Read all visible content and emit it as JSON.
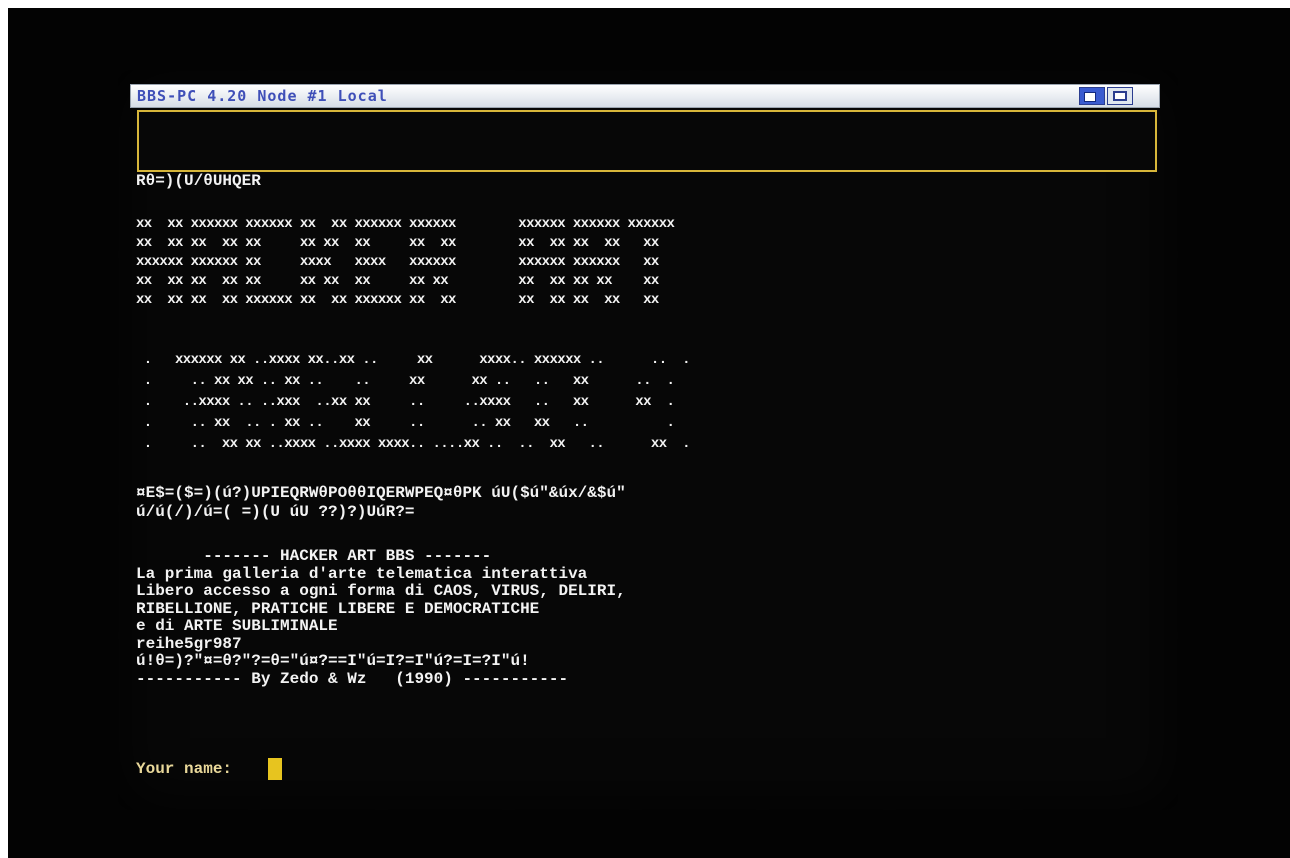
{
  "window": {
    "title": "BBS-PC 4.20 Node #1 Local",
    "gadgets": [
      "depth-icon",
      "zoom-icon"
    ]
  },
  "terminal": {
    "line1": "Rθ=)(U/θUHQER",
    "banner_hacker_art": "xx  xx xxxxxx xxxxxx xx  xx xxxxxx xxxxxx        xxxxxx xxxxxx xxxxxx\nxx  xx xx  xx xx     xx xx  xx     xx  xx        xx  xx xx  xx   xx\nxxxxxx xxxxxx xx     xxxx   xxxx   xxxxxx        xxxxxx xxxxxx   xx\nxx  xx xx  xx xx     xx xx  xx     xx xx         xx  xx xx xx    xx\nxx  xx xx  xx xxxxxx xx  xx xxxxxx xx  xx        xx  xx xx  xx   xx",
    "banner_subtitle": " .   xxxxxx xx ..xxxx xx..xx ..     xx      xxxx.. xxxxxx ..      ..  .\n .     .. xx xx .. xx ..    ..     xx      xx ..   ..   xx      ..  .\n .    ..xxxx .. ..xxx  ..xx xx     ..     ..xxxx   ..   xx      xx  .\n .     .. xx  .. . xx ..    xx     ..      .. xx   xx   ..          .\n .     ..  xx xx ..xxxx ..xxxx xxxx.. ....xx ..  ..  xx   ..      xx  .",
    "garbage2": "¤E$=($=)(ú?)UPIEQRWθPOθθIQERWPEQ¤θPK úU($ú\"&úx/&$ú\"\nú/ú(/)/ú=( =)(U úU ??)?)UúR?=",
    "info_lines": "       ------- HACKER ART BBS -------\nLa prima galleria d'arte telematica interattiva\nLibero accesso a ogni forma di CAOS, VIRUS, DELIRI,\nRIBELLIONE, PRATICHE LIBERE E DEMOCRATICHE\ne di ARTE SUBLIMINALE\nreihe5gr987\nú!θ=)?\"¤=θ?\"?=θ=\"ú¤?==I\"ú=I?=I\"ú?=I=?I\"ú!\n----------- By Zedo & Wz   (1990) -----------",
    "prompt_label": "Your name: "
  },
  "colors": {
    "title_text": "#3f4fb8",
    "status_border": "#d7b63a",
    "cursor": "#e7c41f",
    "text": "#f3f3f3"
  }
}
